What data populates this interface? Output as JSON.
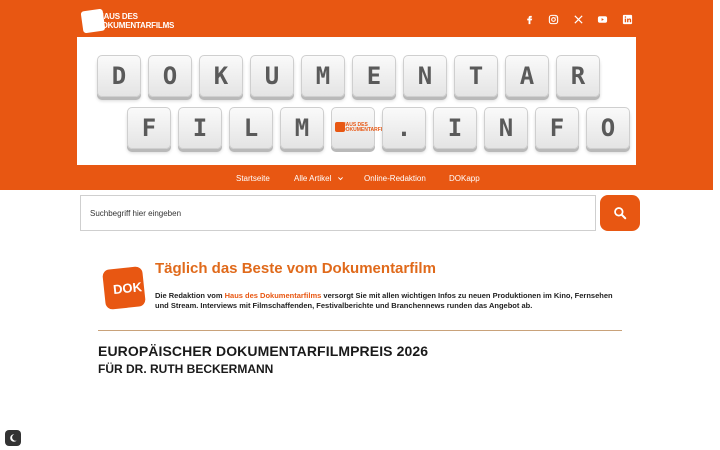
{
  "header": {
    "logo": {
      "line1": "HAUS DES",
      "line2": "DOKUMENTARFILMS"
    },
    "social": [
      "facebook-icon",
      "instagram-icon",
      "x-icon",
      "youtube-icon",
      "linkedin-icon"
    ]
  },
  "banner": {
    "row1": [
      "D",
      "O",
      "K",
      "U",
      "M",
      "E",
      "N",
      "T",
      "A",
      "R"
    ],
    "row2": [
      "F",
      "I",
      "L",
      "M",
      "",
      ".",
      "I",
      "N",
      "F",
      "O"
    ],
    "key_logo": "HAUS DES DOKUMENTARFILMS"
  },
  "nav": {
    "items": [
      "Startseite",
      "Alle Artikel",
      "Online-Redaktion",
      "DOKapp"
    ]
  },
  "search": {
    "placeholder": "Suchbegriff hier eingeben"
  },
  "intro": {
    "logo_text": "DOK",
    "headline": "Täglich das Beste vom Dokumentarfilm",
    "text_before": "Die Redaktion vom ",
    "link": "Haus des Dokumentarfilms",
    "text_after": " versorgt Sie mit allen wichtigen Infos zu neuen Produktionen im Kino, Fernsehen und Stream. Interviews mit Filmschaffenden, Festivalberichte und Branchennews runden das Angebot ab."
  },
  "article": {
    "title": "EUROPÄISCHER DOKUMENTARFILMPREIS 2026",
    "subtitle": "FÜR DR. RUTH BECKERMANN"
  },
  "colors": {
    "accent": "#e85712",
    "headline": "#e06a1b"
  }
}
